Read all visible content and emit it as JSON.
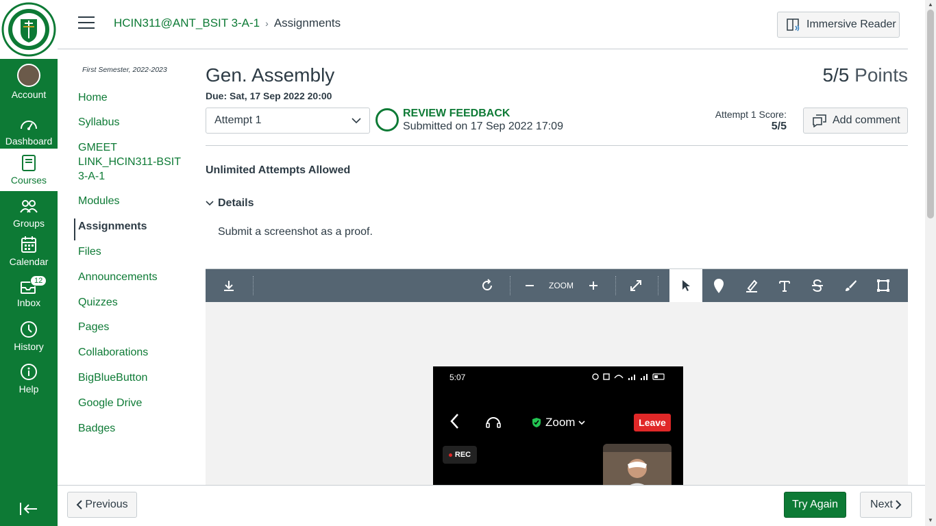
{
  "global_nav": {
    "items": [
      {
        "label": "Account",
        "icon": "avatar"
      },
      {
        "label": "Dashboard",
        "icon": "dashboard-icon"
      },
      {
        "label": "Courses",
        "icon": "courses-icon"
      },
      {
        "label": "Groups",
        "icon": "groups-icon"
      },
      {
        "label": "Calendar",
        "icon": "calendar-icon"
      },
      {
        "label": "Inbox",
        "icon": "inbox-icon",
        "badge": "12"
      },
      {
        "label": "History",
        "icon": "history-icon"
      },
      {
        "label": "Help",
        "icon": "help-icon"
      }
    ],
    "brand_color": "#0d7a35"
  },
  "header": {
    "breadcrumb_course": "HCIN311@ANT_BSIT 3-A-1",
    "breadcrumb_separator": "›",
    "breadcrumb_page": "Assignments",
    "immersive_reader_label": "Immersive Reader"
  },
  "course_nav": {
    "term": "First Semester, 2022-2023",
    "items": [
      {
        "label": "Home"
      },
      {
        "label": "Syllabus"
      },
      {
        "label": "GMEET LINK_HCIN311-BSIT 3-A-1"
      },
      {
        "label": "Modules"
      },
      {
        "label": "Assignments",
        "active": true
      },
      {
        "label": "Files"
      },
      {
        "label": "Announcements"
      },
      {
        "label": "Quizzes"
      },
      {
        "label": "Pages"
      },
      {
        "label": "Collaborations"
      },
      {
        "label": "BigBlueButton"
      },
      {
        "label": "Google Drive"
      },
      {
        "label": "Badges"
      }
    ]
  },
  "assignment": {
    "title": "Gen. Assembly",
    "due": "Due: Sat, 17 Sep 2022 20:00",
    "points_value": "5/5",
    "points_label": "Points",
    "attempt_selected": "Attempt 1",
    "review_feedback": "REVIEW FEEDBACK",
    "submitted_text": "Submitted on 17 Sep 2022 17:09",
    "score_label": "Attempt 1 Score:",
    "score_value": "5/5",
    "add_comment_label": "Add comment",
    "attempts_allowed": "Unlimited Attempts Allowed",
    "details_label": "Details",
    "details_text": "Submit a screenshot as a proof."
  },
  "viewer": {
    "zoom_label": "ZOOM",
    "tools": [
      "download-icon",
      "rotate-icon",
      "zoom-out-icon",
      "zoom-in-icon",
      "fullscreen-icon",
      "pointer-icon",
      "pin-icon",
      "highlight-icon",
      "text-icon",
      "strikeout-icon",
      "freehand-icon",
      "area-icon"
    ],
    "toolbar_color": "#556572"
  },
  "phone_screenshot": {
    "time": "5:07",
    "meeting_title": "Zoom",
    "leave_label": "Leave",
    "rec_label": "REC"
  },
  "footer": {
    "previous_label": "Previous",
    "try_again_label": "Try Again",
    "next_label": "Next"
  }
}
